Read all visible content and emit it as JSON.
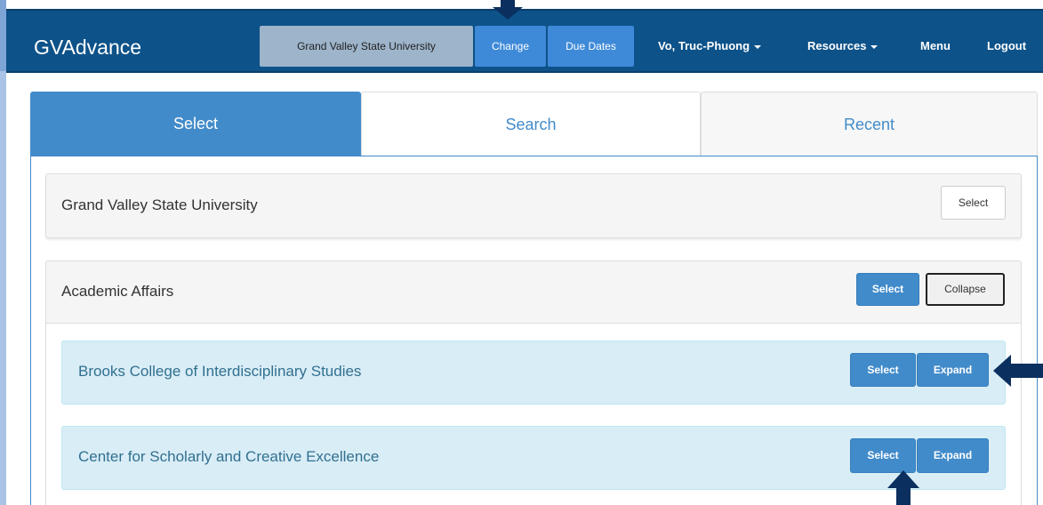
{
  "navbar": {
    "brand": "GVAdvance",
    "institution": "Grand Valley State University",
    "change_label": "Change",
    "due_dates_label": "Due Dates",
    "user_label": "Vo, Truc-Phuong",
    "resources_label": "Resources",
    "menu_label": "Menu",
    "logout_label": "Logout"
  },
  "tabs": [
    {
      "label": "Select",
      "active": true
    },
    {
      "label": "Search",
      "active": false
    },
    {
      "label": "Recent",
      "active": false
    }
  ],
  "units": {
    "root": {
      "name": "Grand Valley State University",
      "select_label": "Select"
    },
    "division": {
      "name": "Academic Affairs",
      "select_label": "Select",
      "collapse_label": "Collapse"
    },
    "children": [
      {
        "name": "Brooks College of Interdisciplinary Studies",
        "select_label": "Select",
        "expand_label": "Expand"
      },
      {
        "name": "Center for Scholarly and Creative Excellence",
        "select_label": "Select",
        "expand_label": "Expand"
      }
    ]
  },
  "colors": {
    "navbar_bg": "#0d5289",
    "primary": "#428bca",
    "info_bg": "#d9edf7",
    "info_text": "#31708f",
    "annotation_arrow": "#0b2f5e"
  },
  "icons": {
    "dropdown": "caret-down-icon",
    "annotation": "arrow-icon"
  }
}
